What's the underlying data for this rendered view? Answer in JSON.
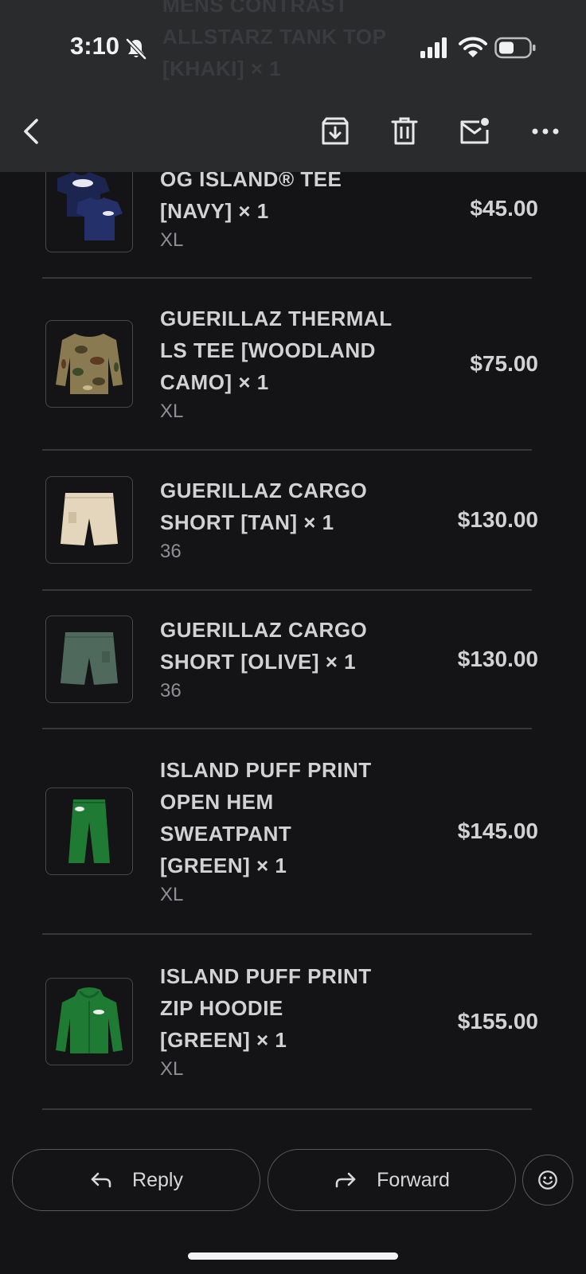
{
  "status_bar": {
    "time": "3:10"
  },
  "behind_text": {
    "lines": [
      "MENS CONTRAST",
      "ALLSTARZ TANK TOP",
      "[KHAKI] × 1"
    ]
  },
  "toolbar": {
    "back_icon": "chevron-left-icon",
    "archive_icon": "archive-icon",
    "delete_icon": "trash-icon",
    "unread_icon": "mark-unread-icon",
    "more_icon": "more-horizontal-icon"
  },
  "items": [
    {
      "name": [
        "OG ISLAND® TEE",
        "[NAVY] × 1"
      ],
      "size": "XL",
      "price": "$45.00",
      "thumb": "tee-navy"
    },
    {
      "name": [
        "GUERILLAZ THERMAL",
        "LS TEE [WOODLAND",
        "CAMO] × 1"
      ],
      "size": "XL",
      "price": "$75.00",
      "thumb": "ls-camo"
    },
    {
      "name": [
        "GUERILLAZ CARGO",
        "SHORT [TAN] × 1"
      ],
      "size": "36",
      "price": "$130.00",
      "thumb": "short-tan"
    },
    {
      "name": [
        "GUERILLAZ CARGO",
        "SHORT [OLIVE] × 1"
      ],
      "size": "36",
      "price": "$130.00",
      "thumb": "short-olive"
    },
    {
      "name": [
        "ISLAND PUFF PRINT",
        "OPEN HEM",
        "SWEATPANT",
        "[GREEN] × 1"
      ],
      "size": "XL",
      "price": "$145.00",
      "thumb": "pant-green"
    },
    {
      "name": [
        "ISLAND PUFF PRINT",
        "ZIP HOODIE",
        "[GREEN] × 1"
      ],
      "size": "XL",
      "price": "$155.00",
      "thumb": "hoodie-green"
    }
  ],
  "actions": {
    "reply_label": "Reply",
    "forward_label": "Forward",
    "emoji_icon": "smiley-icon"
  },
  "colors": {
    "background": "#141416",
    "header": "#2a2b2d",
    "text": "#d2d2d4",
    "muted": "#8e8f93"
  }
}
